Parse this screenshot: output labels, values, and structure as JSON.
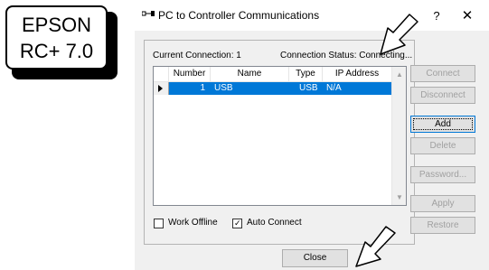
{
  "badge": {
    "line1": "EPSON",
    "line2": "RC+ 7.0"
  },
  "window": {
    "title": "PC to Controller Communications",
    "help": "?",
    "close": "✕"
  },
  "connection": {
    "current": "Current Connection: 1",
    "status": "Connection Status: Connecting..."
  },
  "table": {
    "headers": [
      "Number",
      "Name",
      "Type",
      "IP Address"
    ],
    "rows": [
      {
        "number": "1",
        "name": "USB",
        "type": "USB",
        "ip": "N/A",
        "selected": true
      }
    ]
  },
  "buttons": {
    "connect": "Connect",
    "disconnect": "Disconnect",
    "add": "Add",
    "delete": "Delete",
    "password": "Password...",
    "apply": "Apply",
    "restore": "Restore",
    "close": "Close"
  },
  "options": {
    "work_offline": {
      "label": "Work Offline",
      "checked": false
    },
    "auto_connect": {
      "label": "Auto Connect",
      "checked": true
    }
  },
  "colors": {
    "selection": "#0078d7",
    "dialog_bg": "#f0f0f0"
  }
}
